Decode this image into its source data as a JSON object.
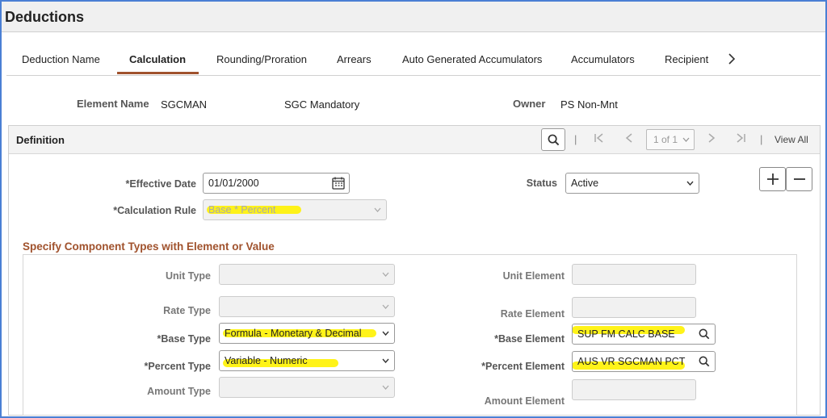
{
  "page": {
    "title": "Deductions"
  },
  "tabs": [
    {
      "label": "Deduction Name",
      "active": false
    },
    {
      "label": "Calculation",
      "active": true
    },
    {
      "label": "Rounding/Proration",
      "active": false
    },
    {
      "label": "Arrears",
      "active": false
    },
    {
      "label": "Auto Generated Accumulators",
      "active": false
    },
    {
      "label": "Accumulators",
      "active": false
    },
    {
      "label": "Recipient",
      "active": false
    }
  ],
  "header": {
    "element_name_label": "Element Name",
    "element_name": "SGCMAN",
    "element_desc": "SGC Mandatory",
    "owner_label": "Owner",
    "owner": "PS Non-Mnt"
  },
  "definition": {
    "title": "Definition",
    "pager": "1 of 1",
    "view_all": "View All",
    "effective_date_label": "*Effective Date",
    "effective_date": "01/01/2000",
    "calculation_rule_label": "*Calculation Rule",
    "calculation_rule": "Base * Percent",
    "status_label": "Status",
    "status": "Active"
  },
  "components": {
    "section_title": "Specify Component Types with Element or Value",
    "unit_type_label": "Unit Type",
    "rate_type_label": "Rate Type",
    "base_type_label": "*Base Type",
    "base_type": "Formula - Monetary & Decimal",
    "percent_type_label": "*Percent Type",
    "percent_type": "Variable - Numeric",
    "amount_type_label": "Amount Type",
    "unit_element_label": "Unit Element",
    "rate_element_label": "Rate Element",
    "base_element_label": "*Base Element",
    "base_element": "SUP FM CALC BASE",
    "percent_element_label": "*Percent Element",
    "percent_element": "AUS VR SGCMAN PCT",
    "amount_element_label": "Amount Element"
  },
  "colors": {
    "highlight": "#fff200",
    "section_title": "#a0522d",
    "tab_underline": "#a0522d",
    "frame": "#4a7fd4"
  },
  "icons": [
    "search-icon",
    "first-page-icon",
    "prev-page-icon",
    "next-page-icon",
    "last-page-icon",
    "calendar-icon",
    "plus-icon",
    "minus-icon",
    "chevron-down-icon",
    "chevron-right-icon"
  ]
}
